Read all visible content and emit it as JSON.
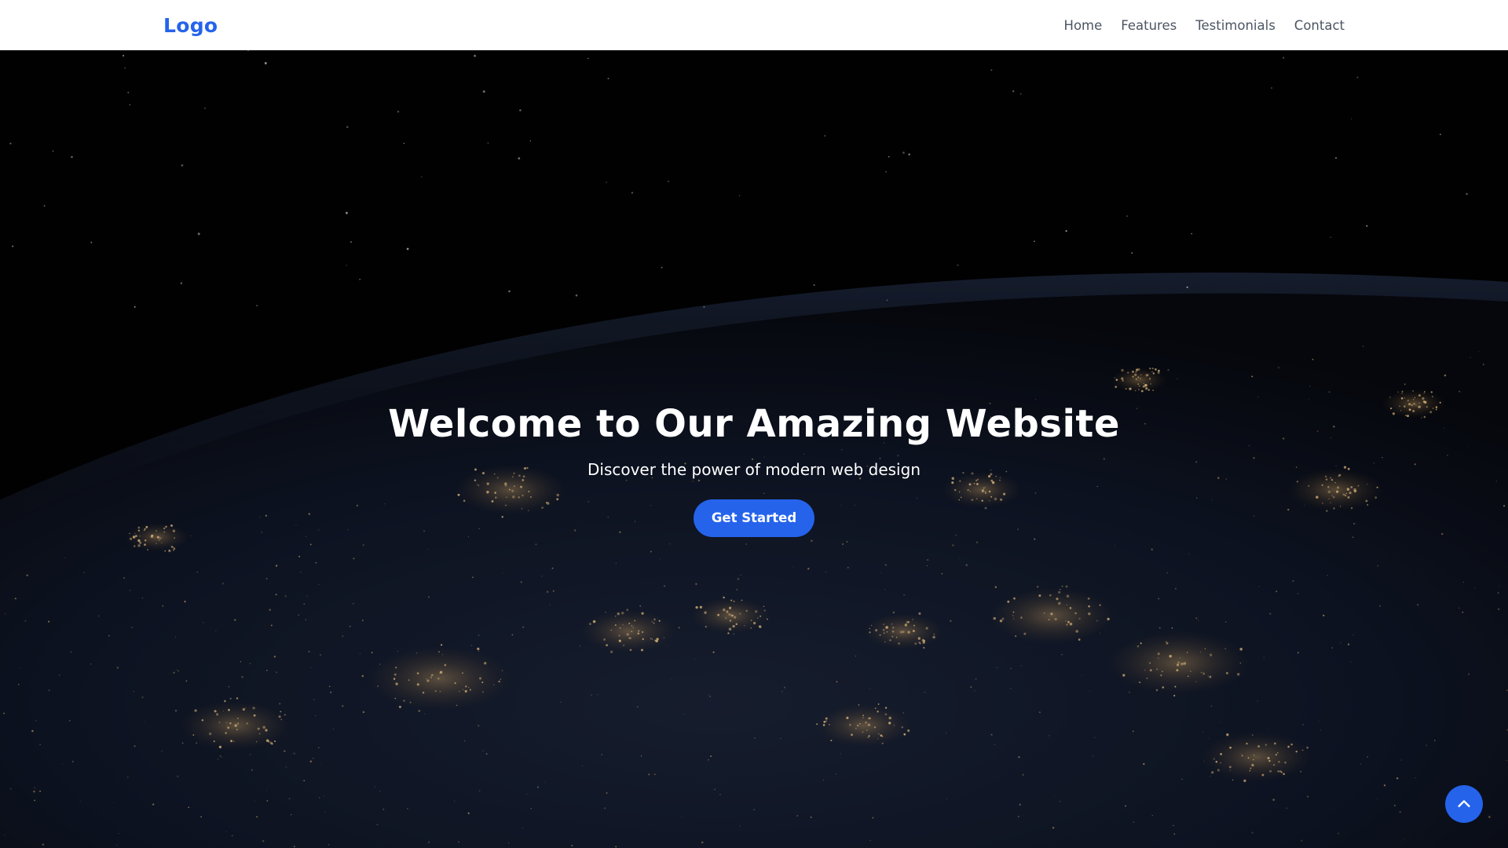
{
  "navbar": {
    "logo": "Logo",
    "links": [
      "Home",
      "Features",
      "Testimonials",
      "Contact"
    ]
  },
  "hero": {
    "title": "Welcome to Our Amazing Website",
    "subtitle": "Discover the power of modern web design",
    "cta_label": "Get Started",
    "background": "earth-at-night-from-space"
  },
  "scroll_top": {
    "icon": "chevron-up-icon"
  },
  "colors": {
    "accent": "#2563eb",
    "nav_text": "#4b5563",
    "nav_bg": "#ffffff"
  }
}
